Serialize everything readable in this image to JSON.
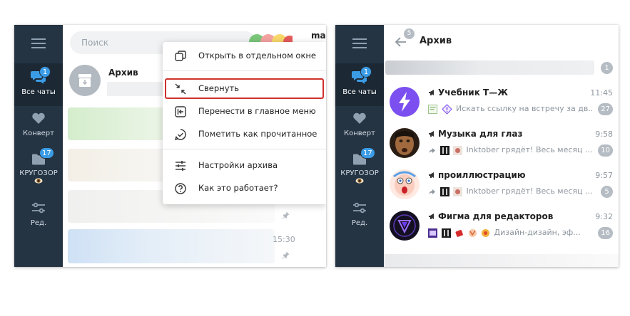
{
  "left_panel": {
    "rail": {
      "items": [
        {
          "label": "Все чаты",
          "badge": "1",
          "icon": "chat-bubbles-icon",
          "active": true
        },
        {
          "label": "Конверт",
          "badge": "",
          "icon": "heart-icon",
          "active": false
        },
        {
          "label": "КРУГОЗОР",
          "badge": "17",
          "icon": "folder-icon",
          "active": false
        },
        {
          "label": "Ред.",
          "badge": "",
          "icon": "sliders-icon",
          "active": false
        }
      ]
    },
    "search": {
      "placeholder": "Поиск"
    },
    "cut_header_text": "mac",
    "archive": {
      "title": "Архив"
    },
    "chat_rows": [
      {
        "time": "",
        "pinned": false
      },
      {
        "time": "",
        "pinned": false
      },
      {
        "time": "",
        "pinned": true
      },
      {
        "time": "15:30",
        "pinned": true
      }
    ],
    "context_menu": {
      "items": [
        {
          "label": "Открыть в отдельном окне",
          "icon": "new-window-icon"
        },
        {
          "label": "Свернуть",
          "icon": "collapse-icon",
          "highlighted": true
        },
        {
          "label": "Перенести в главное меню",
          "icon": "move-to-menu-icon"
        },
        {
          "label": "Пометить как прочитанное",
          "icon": "mark-read-icon"
        },
        {
          "label": "Настройки архива",
          "icon": "settings-sliders-icon"
        },
        {
          "label": "Как это работает?",
          "icon": "help-icon"
        }
      ]
    }
  },
  "right_panel": {
    "rail": {
      "items": [
        {
          "label": "Все чаты",
          "badge": "1",
          "icon": "chat-bubbles-icon",
          "active": true
        },
        {
          "label": "Конверт",
          "badge": "",
          "icon": "heart-icon",
          "active": false
        },
        {
          "label": "КРУГОЗОР",
          "badge": "17",
          "icon": "folder-icon",
          "active": false
        },
        {
          "label": "Ред.",
          "badge": "",
          "icon": "sliders-icon",
          "active": false
        }
      ]
    },
    "header": {
      "title": "Архив",
      "back_count": "5"
    },
    "top_count": "1",
    "chats": [
      {
        "name": "Учебник Т—Ж",
        "time": "11:45",
        "preview": "Искать ссылку на встречу за дв...",
        "unread": "27",
        "avatar": "lightning-avatar"
      },
      {
        "name": "Музыка для глаз",
        "time": "9:58",
        "preview": "Inktober грядёт!  Весь месяц ...",
        "unread": "10",
        "avatar": "face-avatar"
      },
      {
        "name": "проиллюстрацию",
        "time": "9:57",
        "preview": "Inktober грядёт!  Весь месяц ...",
        "unread": "5",
        "avatar": "cartoon-avatar"
      },
      {
        "name": "Фигма для редакторов",
        "time": "9:32",
        "preview": "Дизайн-дизайн, эф...",
        "unread": "16",
        "avatar": "figma-avatar"
      }
    ]
  },
  "colors": {
    "rail_bg": "#253443",
    "rail_active_bg": "#1c2834",
    "accent": "#3b9ce6",
    "highlight_border": "#d0312d",
    "count_pill": "#b5bcc4"
  }
}
